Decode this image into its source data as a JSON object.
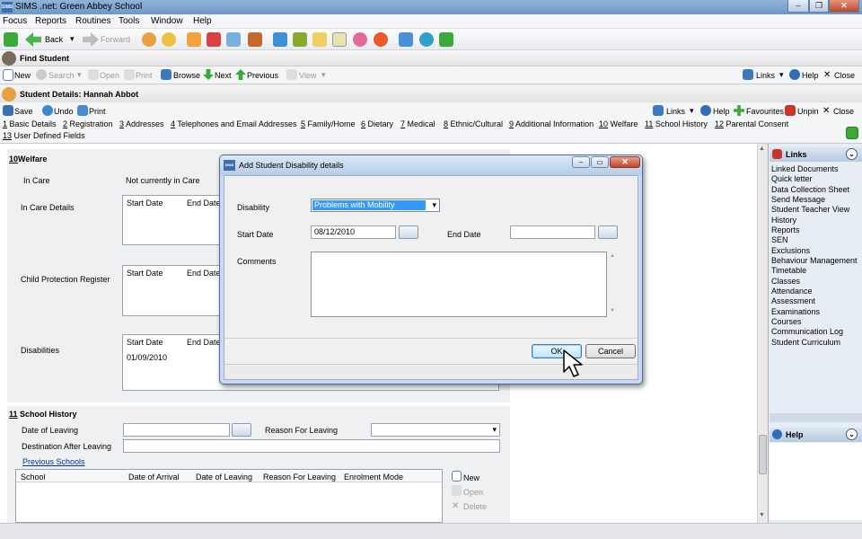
{
  "app": {
    "title": "SIMS .net: Green Abbey School",
    "logo": "SIMS"
  },
  "menu": [
    "Focus",
    "Reports",
    "Routines",
    "Tools",
    "Window",
    "Help"
  ],
  "toolbar": {
    "back": "Back",
    "forward": "Forward"
  },
  "find_student": {
    "title": "Find Student",
    "buttons": {
      "new": "New",
      "search": "Search",
      "open": "Open",
      "print": "Print",
      "browse": "Browse",
      "next": "Next",
      "previous": "Previous",
      "view": "View"
    },
    "links": "Links",
    "help": "Help",
    "close": "Close"
  },
  "student_details": {
    "title": "Student Details: Hannah Abbot",
    "buttons": {
      "save": "Save",
      "undo": "Undo",
      "print": "Print"
    },
    "links": "Links",
    "help": "Help",
    "favourites": "Favourites",
    "unpin": "Unpin",
    "close": "Close",
    "nav": [
      {
        "num": "1",
        "label": "Basic Details"
      },
      {
        "num": "2",
        "label": "Registration"
      },
      {
        "num": "3",
        "label": "Addresses"
      },
      {
        "num": "4",
        "label": "Telephones and Email Addresses"
      },
      {
        "num": "5",
        "label": "Family/Home"
      },
      {
        "num": "6",
        "label": "Dietary"
      },
      {
        "num": "7",
        "label": "Medical"
      },
      {
        "num": "8",
        "label": "Ethnic/Cultural"
      },
      {
        "num": "9",
        "label": "Additional Information"
      },
      {
        "num": "10",
        "label": "Welfare"
      },
      {
        "num": "11",
        "label": "School History"
      },
      {
        "num": "12",
        "label": "Parental Consent"
      },
      {
        "num": "13",
        "label": "User Defined Fields"
      }
    ]
  },
  "welfare": {
    "num": "10",
    "title": "Welfare",
    "in_care_label": "In Care",
    "in_care_value": "Not currently in Care",
    "in_care_details": "In Care Details",
    "child_protection": "Child Protection Register",
    "disabilities": "Disabilities",
    "col_start": "Start Date",
    "col_end": "End Date",
    "disability_row_start": "01/09/2010"
  },
  "school_history": {
    "num": "11",
    "title": "School History",
    "date_of_leaving": "Date of Leaving",
    "reason_for_leaving": "Reason For Leaving",
    "destination": "Destination After Leaving",
    "previous_schools": "Previous Schools",
    "columns": [
      "School",
      "Date of Arrival",
      "Date of Leaving",
      "Reason For Leaving",
      "Enrolment Mode"
    ],
    "actions": {
      "new": "New",
      "open": "Open",
      "delete": "Delete"
    }
  },
  "links_panel": {
    "title": "Links",
    "items": [
      "Linked Documents",
      "Quick letter",
      "Data Collection Sheet",
      "Send Message",
      "Student Teacher View",
      "History",
      "Reports",
      "SEN",
      "Exclusions",
      "Behaviour Management",
      "Timetable",
      "Classes",
      "Attendance",
      "Assessment",
      "Examinations",
      "Courses",
      "Communication Log",
      "Student Curriculum"
    ]
  },
  "help_panel": {
    "title": "Help"
  },
  "dialog": {
    "title": "Add Student Disability details",
    "disability_label": "Disability",
    "disability_value": "Problems with Mobility",
    "start_label": "Start Date",
    "start_value": "08/12/2010",
    "end_label": "End Date",
    "end_value": "",
    "comments_label": "Comments",
    "ok": "OK",
    "cancel": "Cancel"
  },
  "colors": {
    "accent": "#3399ff",
    "link": "#003399",
    "titlebar": "#6e98c4"
  }
}
